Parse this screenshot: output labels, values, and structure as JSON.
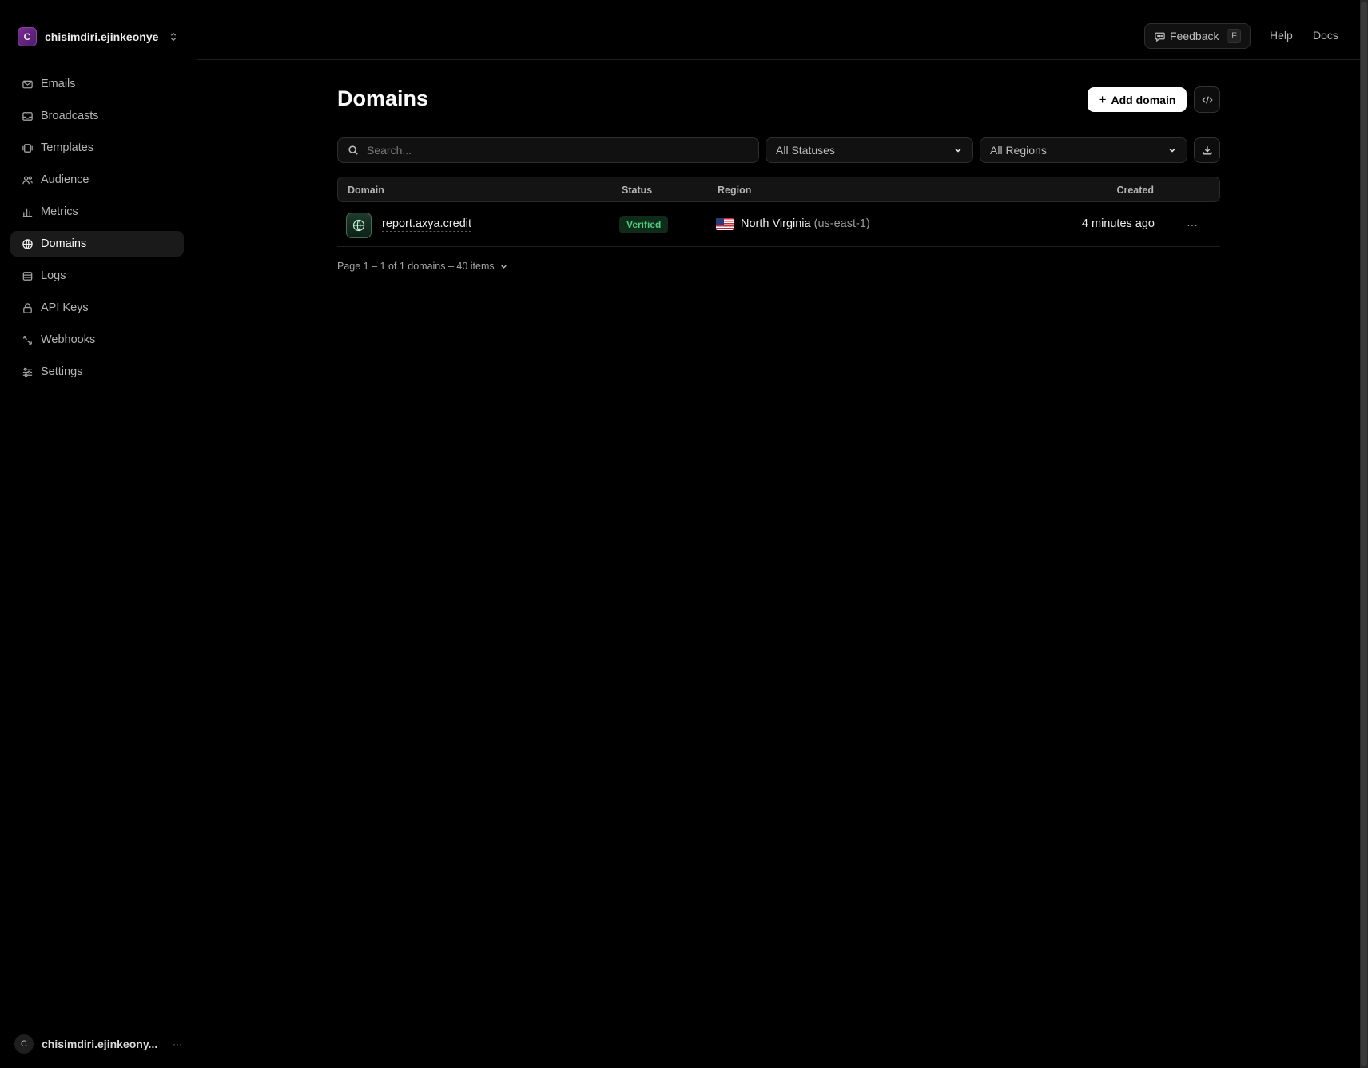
{
  "team": {
    "initial": "C",
    "name": "chisimdiri.ejinkeonye"
  },
  "nav": [
    {
      "label": "Emails",
      "icon": "mail-icon",
      "active": false
    },
    {
      "label": "Broadcasts",
      "icon": "inbox-icon",
      "active": false
    },
    {
      "label": "Templates",
      "icon": "templates-icon",
      "active": false
    },
    {
      "label": "Audience",
      "icon": "users-icon",
      "active": false
    },
    {
      "label": "Metrics",
      "icon": "bar-chart-icon",
      "active": false
    },
    {
      "label": "Domains",
      "icon": "globe-icon",
      "active": true
    },
    {
      "label": "Logs",
      "icon": "logs-icon",
      "active": false
    },
    {
      "label": "API Keys",
      "icon": "lock-icon",
      "active": false
    },
    {
      "label": "Webhooks",
      "icon": "webhook-icon",
      "active": false
    },
    {
      "label": "Settings",
      "icon": "sliders-icon",
      "active": false
    }
  ],
  "user": {
    "initial": "C",
    "name": "chisimdiri.ejinkeony...",
    "more": "···"
  },
  "topbar": {
    "feedback_label": "Feedback",
    "feedback_shortcut": "F",
    "help_label": "Help",
    "docs_label": "Docs"
  },
  "page": {
    "title": "Domains",
    "add_label": "Add domain"
  },
  "filters": {
    "search_placeholder": "Search...",
    "status_selected": "All Statuses",
    "region_selected": "All Regions"
  },
  "table": {
    "headers": {
      "domain": "Domain",
      "status": "Status",
      "region": "Region",
      "created": "Created"
    },
    "rows": [
      {
        "domain": "report.axya.credit",
        "status": "Verified",
        "region_name": "North Virginia",
        "region_code": "(us-east-1)",
        "created": "4 minutes ago",
        "more": "···"
      }
    ]
  },
  "pagination": {
    "text": "Page 1 – 1 of 1 domains – 40 items"
  },
  "colors": {
    "accent_verified": "#4ccf7a",
    "background": "#000000"
  }
}
